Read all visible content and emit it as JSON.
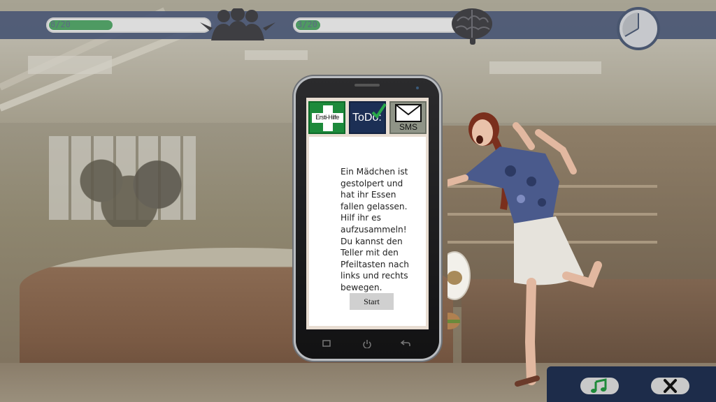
{
  "hud": {
    "friends_progress": {
      "label": "8/20",
      "fraction": 0.4
    },
    "knowledge_progress": {
      "label": "3/20",
      "fraction": 0.15
    },
    "icons": [
      "group-icon",
      "brain-icon",
      "clock-icon"
    ]
  },
  "phone": {
    "apps": {
      "first_aid": {
        "label": "Ersti-Hilfe"
      },
      "todo": {
        "label": "ToDo:"
      },
      "sms": {
        "label": "SMS"
      }
    },
    "message": "Ein Mädchen ist gestolpert und hat ihr Essen fallen gelassen. Hilf ihr es aufzusammeln! Du kannst den Teller mit den Pfeiltasten nach links und rechts bewegen.",
    "start_label": "Start"
  },
  "bottom_bar": {
    "icons": [
      "music-note-icon",
      "close-icon"
    ]
  },
  "colors": {
    "hud": "#4d5a76",
    "progress_fill": "#4e9a62",
    "first_aid_green": "#1d8a3b",
    "todo_navy": "#1c2f55",
    "bottom_bar": "#1d2c4a"
  }
}
